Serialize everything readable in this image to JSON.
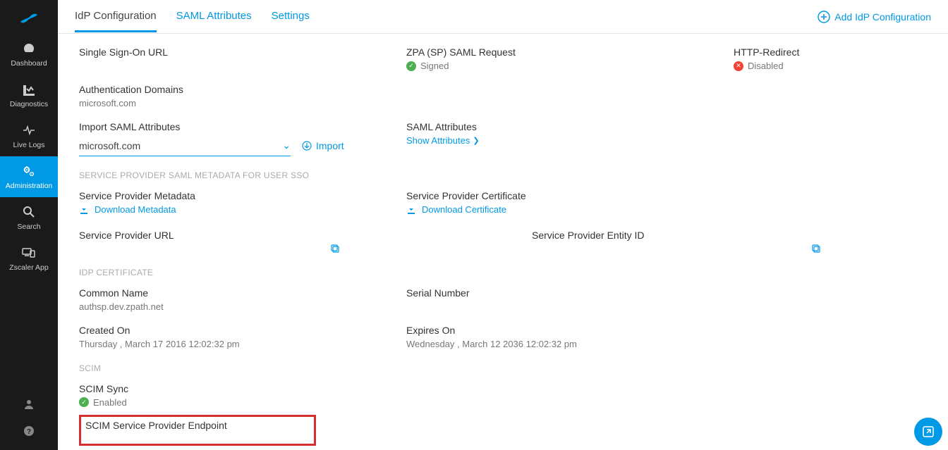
{
  "sidebar": {
    "items": [
      {
        "label": "Dashboard"
      },
      {
        "label": "Diagnostics"
      },
      {
        "label": "Live Logs"
      },
      {
        "label": "Administration"
      },
      {
        "label": "Search"
      },
      {
        "label": "Zscaler App"
      }
    ]
  },
  "tabs": {
    "idp": "IdP Configuration",
    "saml": "SAML Attributes",
    "settings": "Settings"
  },
  "topbar": {
    "add_label": "Add IdP Configuration"
  },
  "sso": {
    "url_label": "Single Sign-On URL",
    "saml_request_label": "ZPA (SP) SAML Request",
    "saml_request_status": "Signed",
    "http_redirect_label": "HTTP-Redirect",
    "http_redirect_status": "Disabled"
  },
  "auth_domains": {
    "label": "Authentication Domains",
    "value": "microsoft.com"
  },
  "import_saml": {
    "label": "Import SAML Attributes",
    "selected": "microsoft.com",
    "import_action": "Import"
  },
  "saml_attrs": {
    "label": "SAML Attributes",
    "show": "Show Attributes"
  },
  "sp_metadata_section": "SERVICE PROVIDER SAML METADATA FOR USER SSO",
  "sp_metadata": {
    "label": "Service Provider Metadata",
    "download": "Download Metadata"
  },
  "sp_cert": {
    "label": "Service Provider Certificate",
    "download": "Download Certificate"
  },
  "sp_url": {
    "label": "Service Provider URL"
  },
  "sp_entity": {
    "label": "Service Provider Entity ID"
  },
  "idp_cert_section": "IdP CERTIFICATE",
  "common_name": {
    "label": "Common Name",
    "value": "authsp.dev.zpath.net"
  },
  "serial_number": {
    "label": "Serial Number"
  },
  "created_on": {
    "label": "Created On",
    "value": "Thursday , March 17 2016 12:02:32 pm"
  },
  "expires_on": {
    "label": "Expires On",
    "value": "Wednesday , March 12 2036 12:02:32 pm"
  },
  "scim_section": "SCIM",
  "scim_sync": {
    "label": "SCIM Sync",
    "status": "Enabled"
  },
  "scim_endpoint": {
    "label": "SCIM Service Provider Endpoint"
  }
}
